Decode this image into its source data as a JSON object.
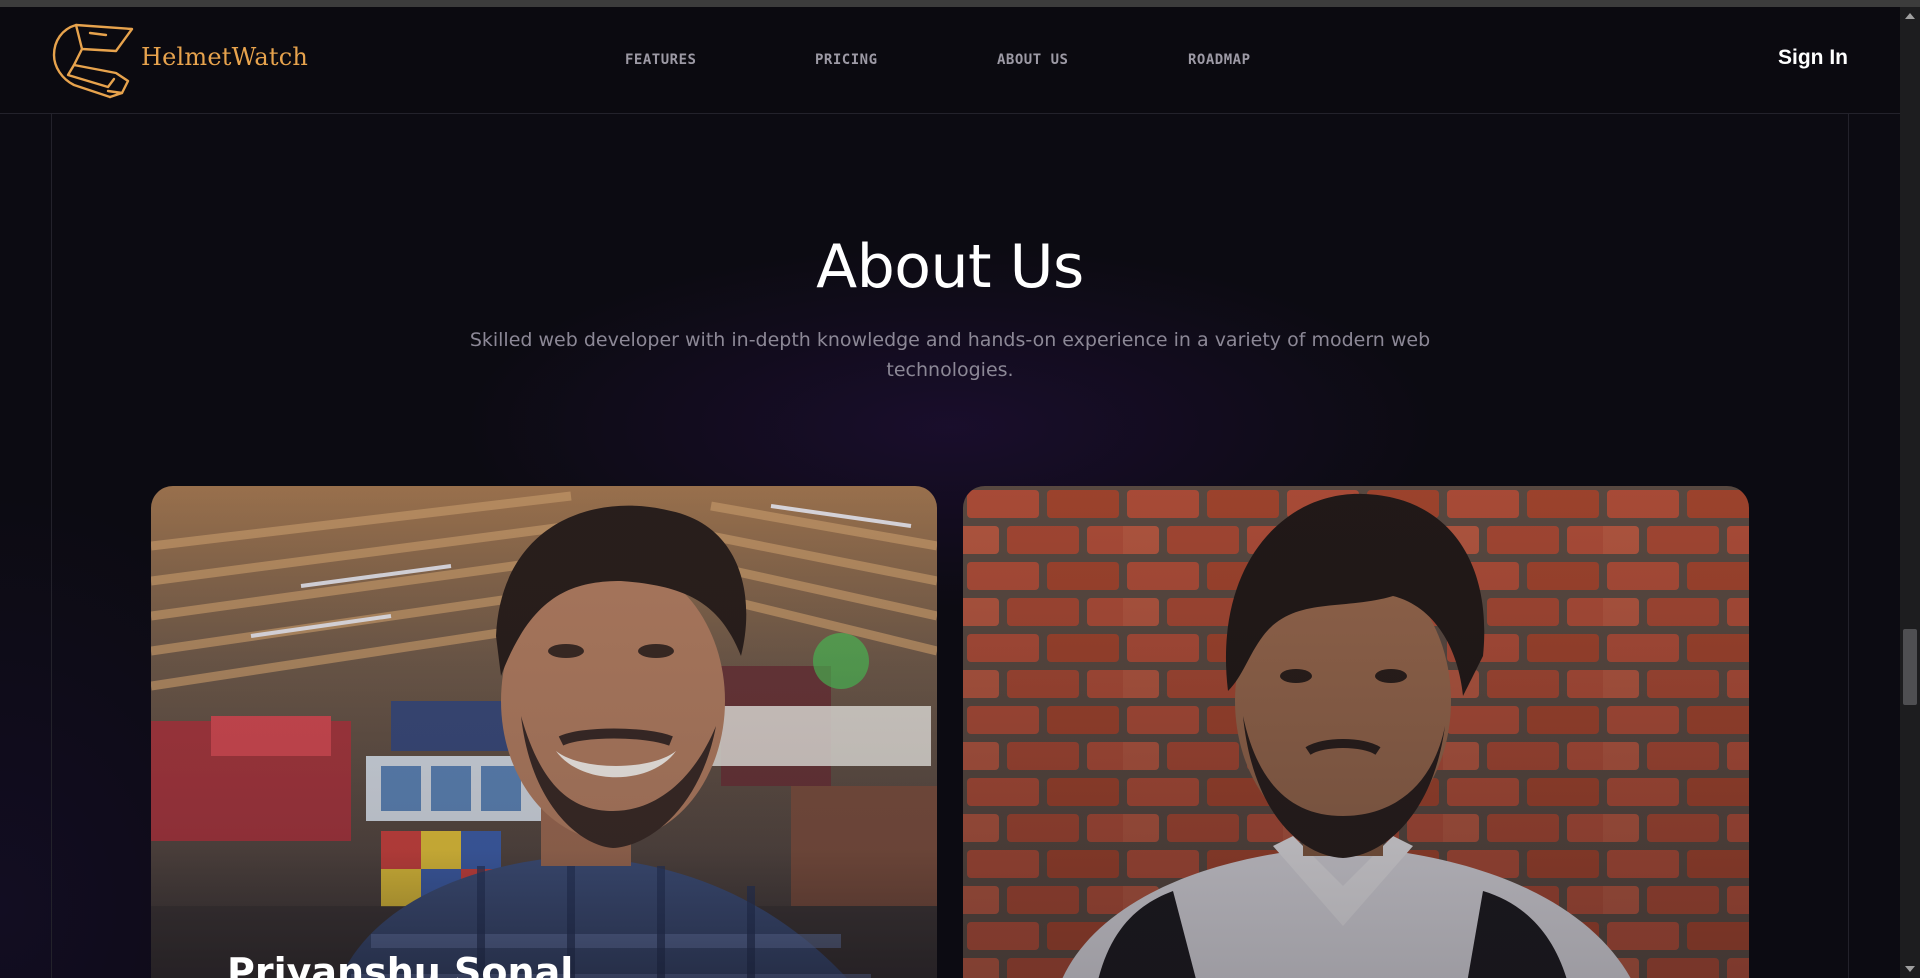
{
  "brand": {
    "name": "HelmetWatch",
    "logo_icon": "helmet-icon",
    "accent": "#e7a34d"
  },
  "nav": {
    "links": [
      "FEATURES",
      "PRICING",
      "ABOUT US",
      "ROADMAP"
    ],
    "sign_in": "Sign In"
  },
  "about": {
    "title": "About Us",
    "subtitle": "Skilled web developer with in-depth knowledge and hands-on experience in a variety of modern web technologies."
  },
  "team": [
    {
      "name": "Priyanshu Sonal",
      "photo": "smiling man in checked shirt at food court"
    },
    {
      "name": "",
      "photo": "young man in white shirt against red brick wall"
    }
  ],
  "colors": {
    "background": "#0c0b12",
    "navbar": "#0b0a10",
    "muted_text": "#8c8896"
  }
}
